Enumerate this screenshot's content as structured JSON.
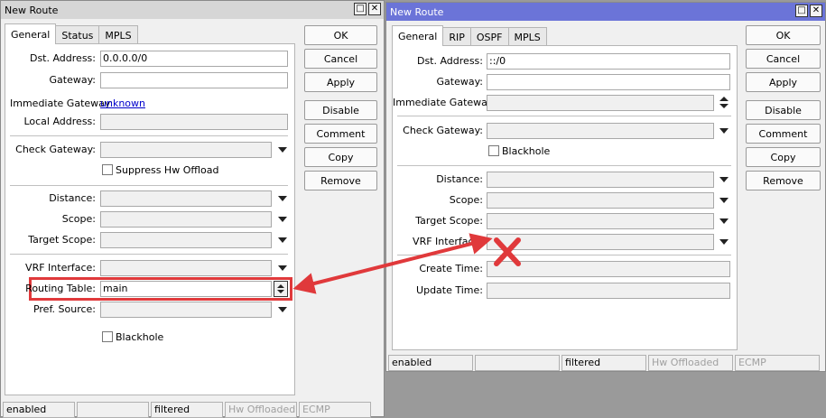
{
  "left_window": {
    "title": "New Route",
    "tabs": [
      "General",
      "Status",
      "MPLS"
    ],
    "buttons": [
      "OK",
      "Cancel",
      "Apply",
      "Disable",
      "Comment",
      "Copy",
      "Remove"
    ],
    "fields": {
      "dst_address_label": "Dst. Address:",
      "dst_address_value": "0.0.0.0/0",
      "gateway_label": "Gateway:",
      "immediate_gateway_label": "Immediate Gateway:",
      "immediate_gateway_value": "unknown",
      "local_address_label": "Local Address:",
      "check_gateway_label": "Check Gateway:",
      "suppress_hw_offload_label": "Suppress Hw Offload",
      "distance_label": "Distance:",
      "scope_label": "Scope:",
      "target_scope_label": "Target Scope:",
      "vrf_interface_label": "VRF Interface:",
      "routing_table_label": "Routing Table:",
      "routing_table_value": "main",
      "pref_source_label": "Pref. Source:",
      "blackhole_label": "Blackhole"
    },
    "status": [
      "enabled",
      "",
      "filtered",
      "Hw Offloaded",
      "ECMP"
    ]
  },
  "right_window": {
    "title": "New Route",
    "tabs": [
      "General",
      "RIP",
      "OSPF",
      "MPLS"
    ],
    "buttons": [
      "OK",
      "Cancel",
      "Apply",
      "Disable",
      "Comment",
      "Copy",
      "Remove"
    ],
    "fields": {
      "dst_address_label": "Dst. Address:",
      "dst_address_value": "::/0",
      "gateway_label": "Gateway:",
      "immediate_gateway_label": "Immediate Gateway:",
      "check_gateway_label": "Check Gateway:",
      "blackhole_label": "Blackhole",
      "distance_label": "Distance:",
      "scope_label": "Scope:",
      "target_scope_label": "Target Scope:",
      "vrf_interface_label": "VRF Interface:",
      "create_time_label": "Create Time:",
      "update_time_label": "Update Time:"
    },
    "status": [
      "enabled",
      "",
      "filtered",
      "Hw Offloaded",
      "ECMP"
    ]
  },
  "annotation": {
    "highlight_color": "#e0393b",
    "arrow_color": "#e0393b",
    "cross_color": "#e0393b"
  }
}
